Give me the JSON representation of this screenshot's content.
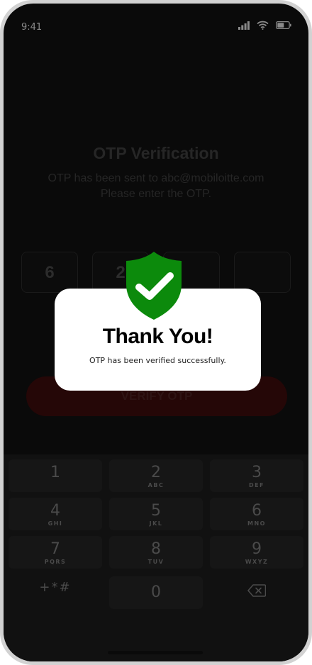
{
  "status_bar": {
    "time": "9:41"
  },
  "otp_page": {
    "title": "OTP Verification",
    "subtitle_line1": "OTP has been sent to abc@mobiloitte.com",
    "subtitle_line2": "Please enter the OTP.",
    "digits": [
      "6",
      "2",
      "",
      "",
      ""
    ],
    "verify_label": "VERIFY OTP"
  },
  "modal": {
    "title": "Thank You!",
    "message": "OTP has been verified successfully.",
    "icon": "shield-check-icon",
    "accent_color": "#0c8a0c"
  },
  "keypad": {
    "keys": [
      {
        "num": "1",
        "letters": ""
      },
      {
        "num": "2",
        "letters": "ABC"
      },
      {
        "num": "3",
        "letters": "DEF"
      },
      {
        "num": "4",
        "letters": "GHI"
      },
      {
        "num": "5",
        "letters": "JKL"
      },
      {
        "num": "6",
        "letters": "MNO"
      },
      {
        "num": "7",
        "letters": "PQRS"
      },
      {
        "num": "8",
        "letters": "TUV"
      },
      {
        "num": "9",
        "letters": "WXYZ"
      },
      {
        "num": "+*#",
        "letters": ""
      },
      {
        "num": "0",
        "letters": ""
      }
    ],
    "delete_icon": "backspace-icon"
  }
}
